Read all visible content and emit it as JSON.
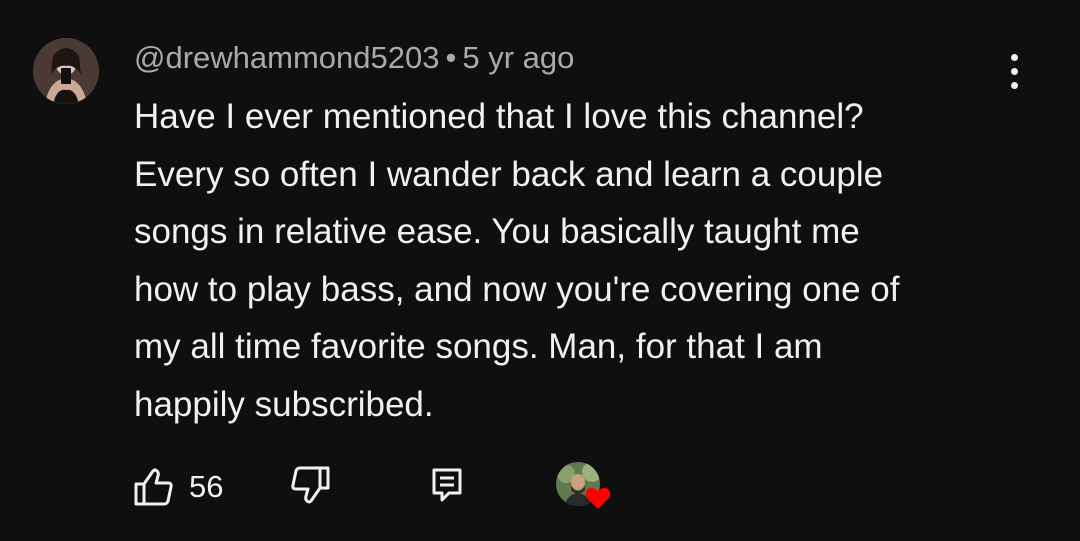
{
  "comment": {
    "author": "@drewhammond5203",
    "separator": "•",
    "time_ago": "5 yr ago",
    "text_lines": [
      "Have I ever mentioned that I love this channel?",
      "Every so often I wander back and learn a couple",
      "songs in relative ease. You basically taught me",
      "how to play bass, and now you're covering one of",
      "my all time favorite songs. Man, for that I am",
      "happily subscribed."
    ],
    "like_count": "56"
  },
  "icons": {
    "menu": "more-vert-icon",
    "like": "thumbs-up-icon",
    "dislike": "thumbs-down-icon",
    "reply": "reply-comment-icon",
    "creator_heart": "heart-icon"
  },
  "colors": {
    "background": "#0f0f0f",
    "text": "#f1f1f1",
    "secondary_text": "#aaaaaa",
    "heart": "#ff0000"
  }
}
